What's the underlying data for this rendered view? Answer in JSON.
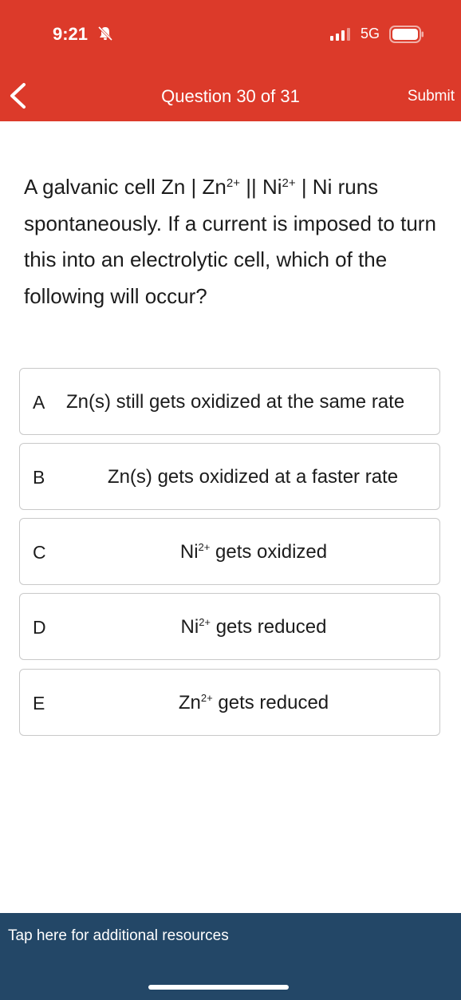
{
  "status_bar": {
    "time": "9:21",
    "network": "5G"
  },
  "header": {
    "title": "Question 30 of 31",
    "submit_label": "Submit"
  },
  "question": {
    "line1": "A galvanic cell Zn | Zn",
    "sup1": "2+",
    "line1b": " || Ni",
    "sup2": "2+",
    "line1c": " | Ni runs spontaneously. If a current is imposed to turn this into an electrolytic cell, which of the following will occur?"
  },
  "answers": [
    {
      "letter": "A",
      "text": "Zn(s) still gets oxidized at the same rate"
    },
    {
      "letter": "B",
      "text": "Zn(s) gets oxidized at a faster rate"
    },
    {
      "letter": "C",
      "text_pre": "Ni",
      "sup": "2+",
      "text_post": " gets oxidized"
    },
    {
      "letter": "D",
      "text_pre": "Ni",
      "sup": "2+",
      "text_post": " gets reduced"
    },
    {
      "letter": "E",
      "text_pre": "Zn",
      "sup": "2+",
      "text_post": " gets reduced"
    }
  ],
  "footer": {
    "resources_label": "Tap here for additional resources"
  },
  "colors": {
    "header_bg": "#dc3a2a",
    "footer_bg": "#234767",
    "border": "#c9c9c9"
  }
}
